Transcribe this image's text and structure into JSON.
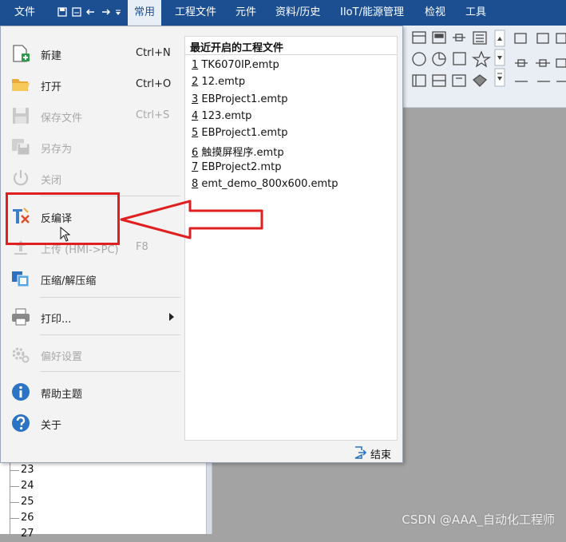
{
  "menubar": {
    "file": "文件",
    "tabs": [
      "常用",
      "工程文件",
      "元件",
      "资料/历史",
      "IIoT/能源管理",
      "检视",
      "工具"
    ],
    "colors": {
      "bar": "#1c4f92",
      "active_bg": "#e8eef6"
    }
  },
  "file_menu": {
    "new": {
      "label": "新建",
      "shortcut": "Ctrl+N"
    },
    "open": {
      "label": "打开",
      "shortcut": "Ctrl+O"
    },
    "save": {
      "label": "保存文件",
      "shortcut": "Ctrl+S"
    },
    "save_as": {
      "label": "另存为"
    },
    "close": {
      "label": "关闭"
    },
    "decompile": {
      "label": "反编译"
    },
    "upload": {
      "label": "上传 (HMI->PC)",
      "shortcut": "F8"
    },
    "compress": {
      "label": "压缩/解压缩"
    },
    "print": {
      "label": "打印..."
    },
    "preferences": {
      "label": "偏好设置"
    },
    "help": {
      "label": "帮助主题"
    },
    "about": {
      "label": "关于"
    }
  },
  "recent": {
    "title": "最近开启的工程文件",
    "items": [
      {
        "num": "1",
        "name": "TK6070IP.emtp"
      },
      {
        "num": "2",
        "name": "12.emtp"
      },
      {
        "num": "3",
        "name": "EBProject1.emtp"
      },
      {
        "num": "4",
        "name": "123.emtp"
      },
      {
        "num": "5",
        "name": "EBProject1.emtp"
      },
      {
        "num": "6",
        "name": "触摸屏程序.emtp"
      },
      {
        "num": "7",
        "name": "EBProject2.mtp"
      },
      {
        "num": "8",
        "name": "emt_demo_800x600.emtp"
      }
    ]
  },
  "exit_label": "结束",
  "tree": {
    "rows": [
      "23",
      "24",
      "25",
      "26",
      "27"
    ]
  },
  "watermark": "CSDN @AAA_自动化工程师",
  "annotation": {
    "color": "#e02020"
  }
}
